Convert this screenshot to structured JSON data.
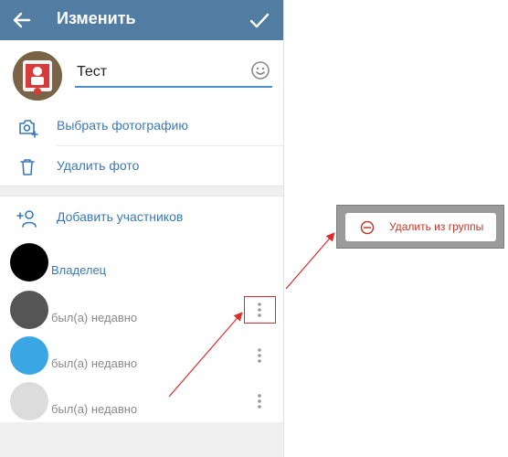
{
  "header": {
    "title": "Изменить"
  },
  "profile": {
    "name_value": "Тест"
  },
  "menu": {
    "choose_photo": "Выбрать фотографию",
    "delete_photo": "Удалить фото",
    "add_members": "Добавить участников"
  },
  "members": [
    {
      "status": "Владелец",
      "avatar_color": "#000000",
      "role": "owner"
    },
    {
      "status": "был(а) недавно",
      "avatar_color": "#555555",
      "role": "member"
    },
    {
      "status": "был(а) недавно",
      "avatar_color": "#3aa6e3",
      "role": "member"
    },
    {
      "status": "был(а) недавно",
      "avatar_color": "#dcdcdc",
      "role": "member"
    }
  ],
  "popup": {
    "remove_from_group": "Удалить из группы"
  },
  "colors": {
    "appbar": "#517da2",
    "accent": "#3b79b6",
    "annotation_red": "#e02b2b",
    "danger_text": "#c0392b"
  },
  "icons": {
    "back": "arrow-left",
    "save": "checkmark",
    "emoji": "smiley-face",
    "camera": "camera-plus",
    "trash": "trash-can",
    "add_user": "person-plus",
    "more": "vertical-dots",
    "remove": "minus-circle"
  }
}
